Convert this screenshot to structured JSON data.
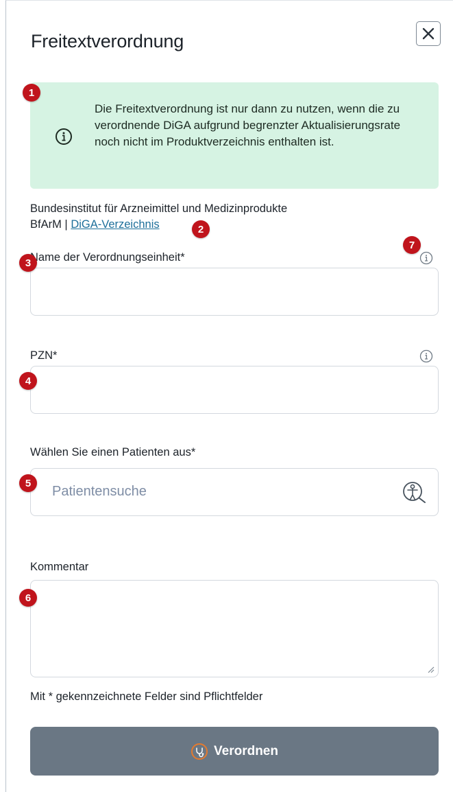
{
  "dialog": {
    "title": "Freitextverordnung"
  },
  "notice": {
    "text": "Die Freitextverordnung ist nur dann zu nutzen, wenn die zu verordnende DiGA aufgrund begrenzter Aktualisierungsrate noch nicht im Produktverzeichnis enthalten ist."
  },
  "authority": {
    "name": "Bundesinstitut für Arzneimittel und Medizinprodukte",
    "short": "BfArM |",
    "link_label": "DiGA-Verzeichnis"
  },
  "fields": {
    "unit_name_label": "Name der Verordnungseinheit*",
    "unit_name_value": "",
    "pzn_label": "PZN*",
    "pzn_value": "",
    "patient_label": "Wählen Sie einen Patienten aus*",
    "patient_placeholder": "Patientensuche",
    "comment_label": "Kommentar",
    "comment_value": ""
  },
  "required_note": "Mit * gekennzeichnete Felder sind Pflichtfelder",
  "submit": {
    "label": "Verordnen",
    "icon": "stethoscope-icon"
  },
  "markers": [
    "1",
    "2",
    "3",
    "4",
    "5",
    "6",
    "7"
  ],
  "colors": {
    "notice_bg": "#d6f3e3",
    "badge": "#c0141c",
    "link": "#1d6f9a",
    "button_bg": "#6a7784",
    "button_icon": "#e57a2e",
    "placeholder": "#7e8da5"
  },
  "icons": {
    "close": "close-icon",
    "notice": "info-circle-icon",
    "field_info": "info-circle-icon",
    "patient_search": "patient-search-icon",
    "resize": "resize-grip-icon"
  }
}
